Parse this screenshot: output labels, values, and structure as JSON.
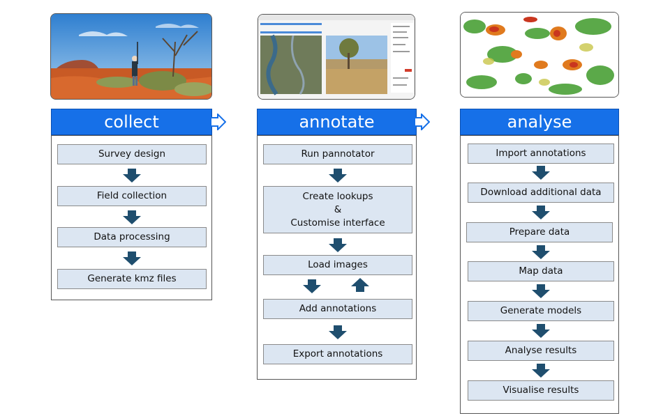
{
  "colors": {
    "header_bg": "#1670e8",
    "step_bg": "#dce6f2",
    "arrow": "#1f4e6e"
  },
  "columns": [
    {
      "title": "collect",
      "image": "outback-field-survey-photo",
      "steps": [
        "Survey design",
        "Field collection",
        "Data processing",
        "Generate kmz files"
      ]
    },
    {
      "title": "annotate",
      "image": "pannotator-app-screenshot",
      "steps": [
        "Run pannotator",
        "Create lookups\n&\nCustomise interface",
        "Load images",
        "Add annotations",
        "Export annotations"
      ]
    },
    {
      "title": "analyse",
      "image": "classified-landcover-map",
      "steps": [
        "Import annotations",
        "Download additional data",
        "Prepare data",
        "Map data",
        "Generate models",
        "Analyse results",
        "Visualise results"
      ]
    }
  ]
}
